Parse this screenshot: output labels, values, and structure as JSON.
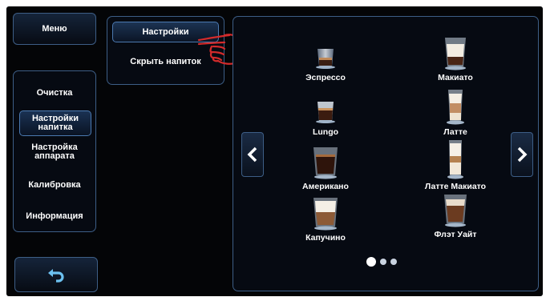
{
  "menu": {
    "label": "Меню"
  },
  "sidebar": {
    "items": [
      {
        "label": "Очистка"
      },
      {
        "label": "Настройки напитка",
        "active": true
      },
      {
        "label": "Настройка аппарата"
      },
      {
        "label": "Калибровка"
      },
      {
        "label": "Информация"
      }
    ]
  },
  "back": {
    "icon": "back-arrow-icon"
  },
  "submenu": {
    "items": [
      {
        "label": "Настройки",
        "active": true
      },
      {
        "label": "Скрыть напиток"
      }
    ]
  },
  "drinks": [
    {
      "label": "Эспрессо",
      "type": "espresso"
    },
    {
      "label": "Макиато",
      "type": "macchiato"
    },
    {
      "label": "Lungo",
      "type": "lungo"
    },
    {
      "label": "Латте",
      "type": "latte"
    },
    {
      "label": "Американо",
      "type": "americano"
    },
    {
      "label": "Латте Макиато",
      "type": "latte-macchiato"
    },
    {
      "label": "Капучино",
      "type": "cappuccino"
    },
    {
      "label": "Флэт Уайт",
      "type": "flat-white"
    }
  ],
  "pagination": {
    "pages": 3,
    "current": 1
  },
  "colors": {
    "accent": "#3d5e86",
    "active_border": "#4b79b0",
    "pointer": "#d42b2b"
  }
}
